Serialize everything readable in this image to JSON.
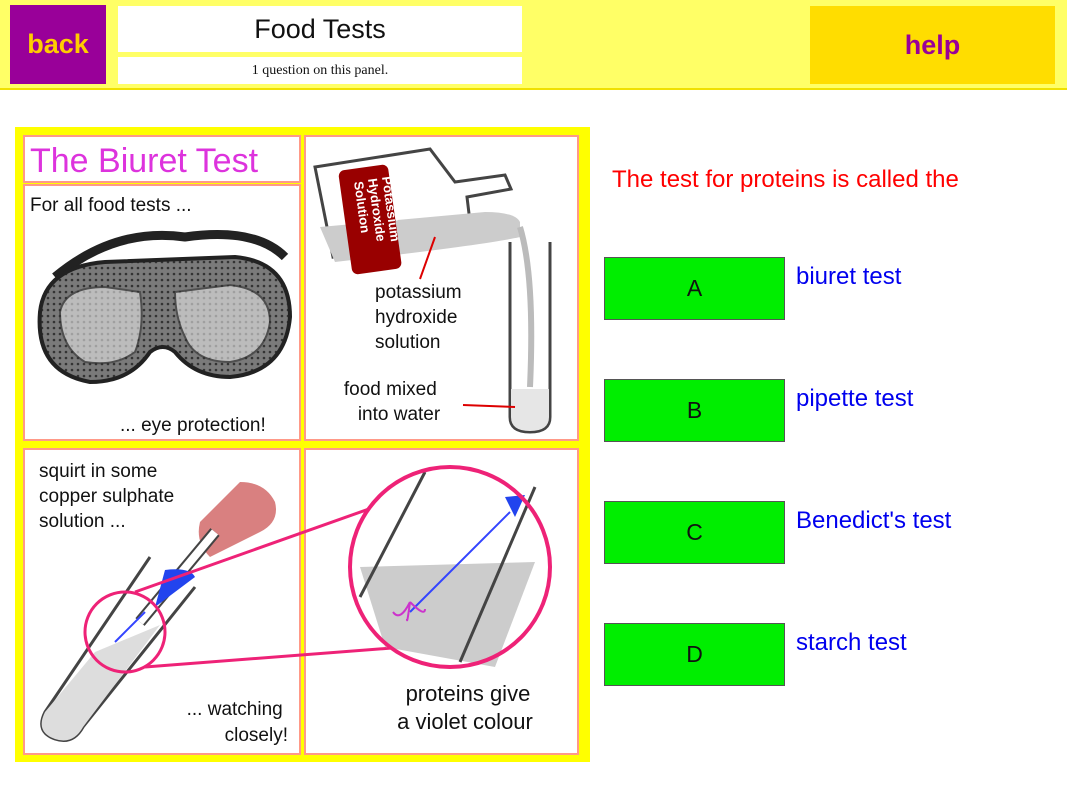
{
  "header": {
    "back_label": "back",
    "title": "Food Tests",
    "subtitle": "1 question on this panel.",
    "help_label": "help"
  },
  "illustration": {
    "title": "The Biuret Test",
    "panel1_top": "For all food tests ...",
    "panel1_bottom": "... eye protection!",
    "bottle_label": [
      "Potassium",
      "Hydroxide",
      "Solution"
    ],
    "panel2_label1": [
      "potassium",
      "hydroxide",
      "solution"
    ],
    "panel2_label2": [
      "food mixed",
      "into water"
    ],
    "panel3_top": [
      "squirt in some",
      "copper sulphate",
      "solution ..."
    ],
    "panel3_bottom": [
      "... watching",
      "closely!"
    ],
    "panel4_bottom": [
      "proteins give",
      "a violet colour"
    ]
  },
  "question": "The test for proteins is called the",
  "answers": [
    {
      "letter": "A",
      "text": "biuret test"
    },
    {
      "letter": "B",
      "text": "pipette test"
    },
    {
      "letter": "C",
      "text": "Benedict's test"
    },
    {
      "letter": "D",
      "text": "starch test"
    }
  ],
  "colors": {
    "top_bar": "#ffff66",
    "back_button": "#990099",
    "help_button": "#ffdd00",
    "answer_button": "#00ee00",
    "question_text": "#ff0000",
    "answer_text": "#0000ee"
  }
}
